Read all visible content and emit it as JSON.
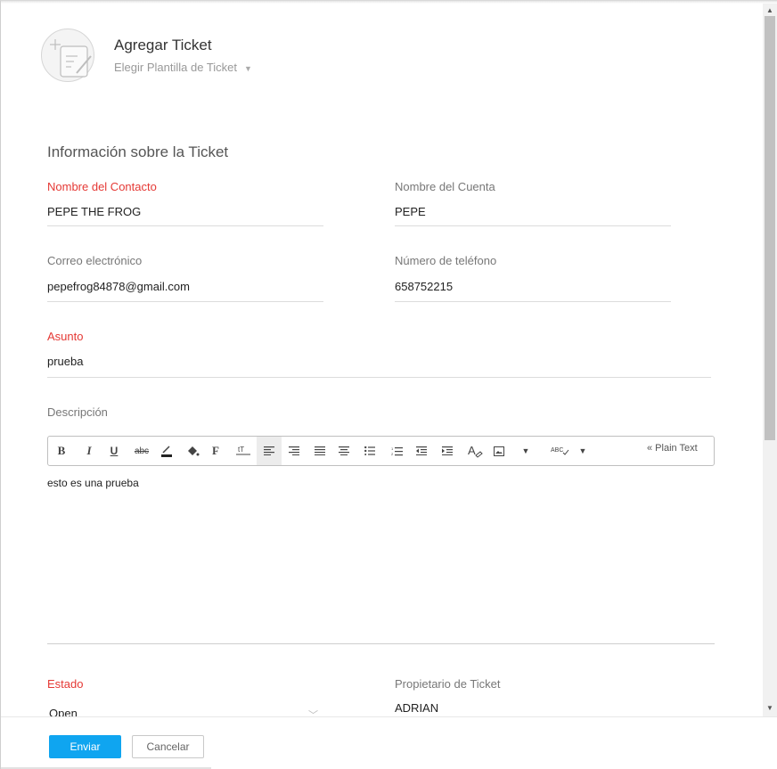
{
  "header": {
    "title": "Agregar Ticket",
    "template_label": "Elegir Plantilla de Ticket"
  },
  "section": {
    "title": "Información sobre la Ticket"
  },
  "fields": {
    "contact_name": {
      "label": "Nombre del Contacto",
      "value": "PEPE THE FROG",
      "required": true
    },
    "account_name": {
      "label": "Nombre del Cuenta",
      "value": "PEPE",
      "required": false
    },
    "email": {
      "label": "Correo electrónico",
      "value": "pepefrog84878@gmail.com",
      "required": false
    },
    "phone": {
      "label": "Número de teléfono",
      "value": "658752215",
      "required": false
    },
    "subject": {
      "label": "Asunto",
      "value": "prueba",
      "required": true
    },
    "description": {
      "label": "Descripción",
      "value": "esto es una prueba"
    },
    "status": {
      "label": "Estado",
      "value": "Open",
      "required": true
    },
    "owner": {
      "label": "Propietario de Ticket",
      "value": "ADRIAN",
      "required": false
    }
  },
  "editor": {
    "plain_text_label": "« Plain Text",
    "tools": [
      "bold-icon",
      "italic-icon",
      "underline-icon",
      "strikethrough-icon",
      "font-color-icon",
      "fill-color-icon",
      "font-family-icon",
      "font-size-icon",
      "align-left-icon",
      "align-right-icon",
      "justify-icon",
      "align-center-icon",
      "bullet-list-icon",
      "numbered-list-icon",
      "outdent-icon",
      "indent-icon",
      "clear-format-icon",
      "image-icon",
      "more-dropdown-icon",
      "spellcheck-icon",
      "spellcheck-dropdown-icon"
    ]
  },
  "footer": {
    "submit_label": "Enviar",
    "cancel_label": "Cancelar"
  },
  "colors": {
    "required_label": "#e53935",
    "primary_button": "#0fa5f0"
  }
}
